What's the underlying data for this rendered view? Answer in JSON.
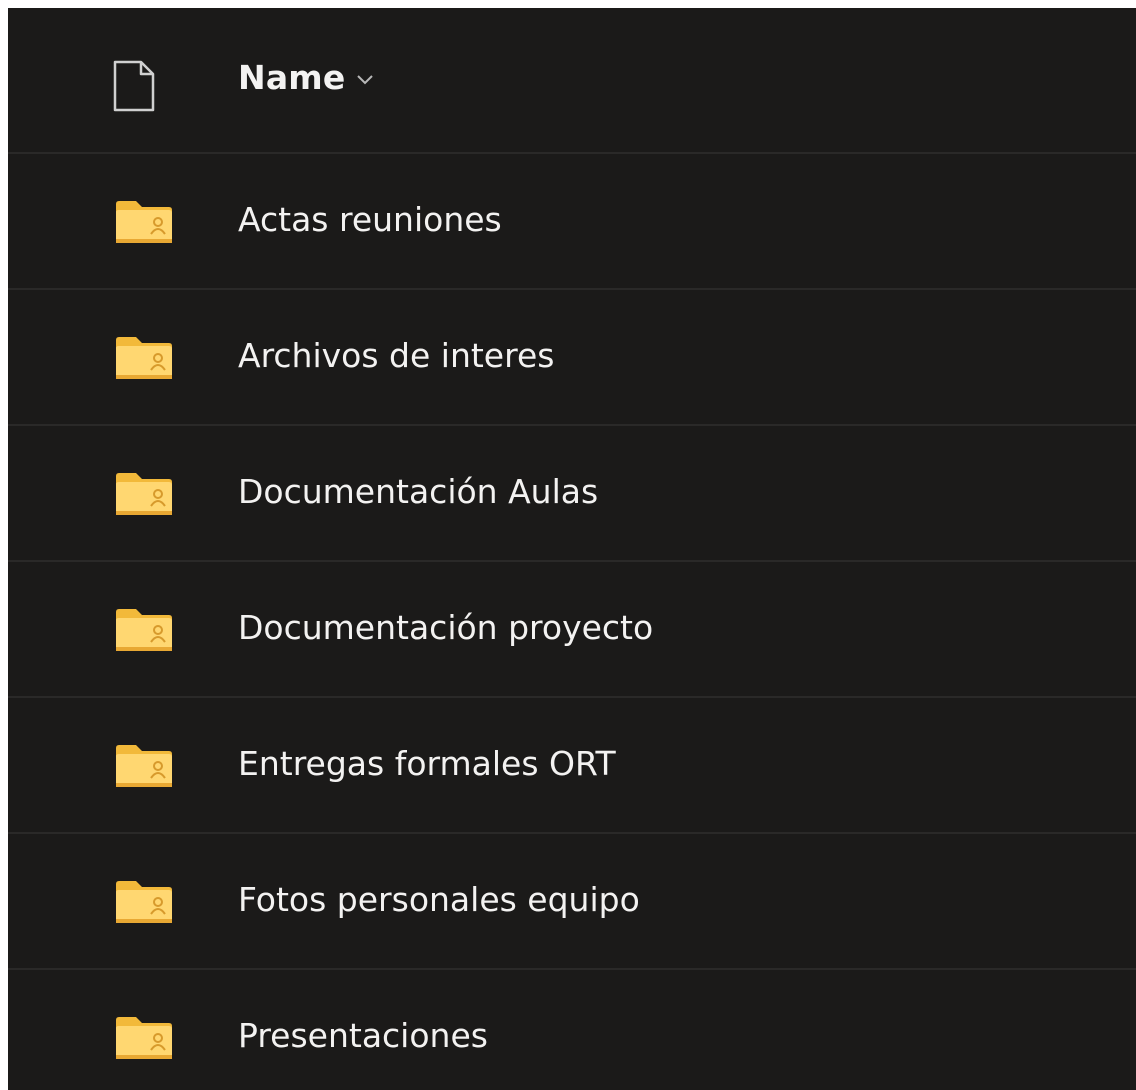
{
  "header": {
    "name_label": "Name",
    "file_type_icon": "document-icon",
    "sort_icon": "chevron-down-icon"
  },
  "items": [
    {
      "name": "Actas reuniones",
      "icon": "shared-folder-icon"
    },
    {
      "name": "Archivos de interes",
      "icon": "shared-folder-icon"
    },
    {
      "name": "Documentación Aulas",
      "icon": "shared-folder-icon"
    },
    {
      "name": "Documentación proyecto",
      "icon": "shared-folder-icon"
    },
    {
      "name": "Entregas formales ORT",
      "icon": "shared-folder-icon"
    },
    {
      "name": "Fotos personales equipo",
      "icon": "shared-folder-icon"
    },
    {
      "name": "Presentaciones",
      "icon": "shared-folder-icon"
    }
  ],
  "colors": {
    "background": "#1b1a19",
    "divider": "#2a2928",
    "text": "#f3f2f1",
    "folder_back": "#f2b93a",
    "folder_front": "#ffd771",
    "folder_badge": "#d79a2c"
  }
}
